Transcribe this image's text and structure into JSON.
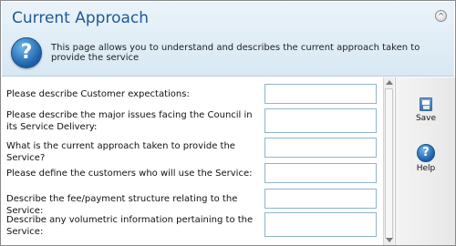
{
  "header": {
    "title": "Current Approach",
    "description": "This page allows you to understand and describes the current approach taken to provide the service",
    "help_glyph": "?",
    "collapse_glyph": "^"
  },
  "form": {
    "questions": [
      {
        "label": "Please describe Customer expectations:",
        "value": ""
      },
      {
        "label": "Please describe the major issues facing the Council in its Service Delivery:",
        "value": ""
      },
      {
        "label": "What is the current approach taken to provide the Service?",
        "value": ""
      },
      {
        "label": "Please define the customers who will use the Service:",
        "value": ""
      },
      {
        "label": "Describe the fee/payment structure relating to the Service:",
        "value": ""
      },
      {
        "label": "Describe any volumetric information pertaining to the Service:",
        "value": ""
      }
    ]
  },
  "toolbar": {
    "save_label": "Save",
    "help_label": "Help",
    "help_glyph": "?"
  },
  "colors": {
    "title": "#1f5a94",
    "header_bg": "#dce9f4",
    "field_border": "#8fb5cc",
    "icon_blue": "#1a5fa8"
  }
}
